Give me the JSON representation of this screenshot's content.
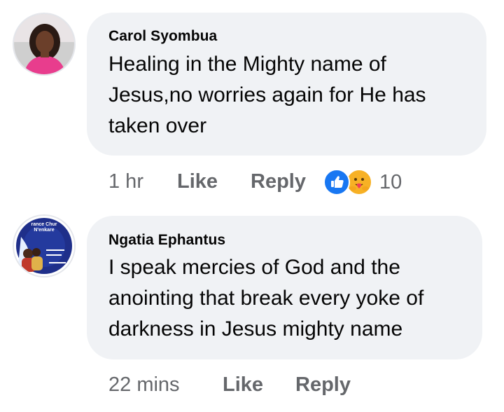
{
  "comments": [
    {
      "author": "Carol Syombua",
      "text_lines": [
        "Healing in the Mighty name of",
        "Jesus,no worries again for He has",
        "taken over"
      ],
      "time": "1 hr",
      "like_label": "Like",
      "reply_label": "Reply",
      "reactions": [
        "like-reaction",
        "care-reaction"
      ],
      "reaction_count": "10"
    },
    {
      "author": "Ngatia Ephantus",
      "avatar_text": [
        "rance Chur",
        "N'enkare"
      ],
      "text_lines": [
        "I speak mercies of God and the",
        "anointing that break every yoke of",
        "darkness in Jesus mighty name"
      ],
      "time": "22 mins",
      "like_label": "Like",
      "reply_label": "Reply"
    }
  ],
  "colors": {
    "bubble": "#f0f2f5",
    "meta_text": "#65676b",
    "like_blue": "#1877f2",
    "care_yellow": "#f7b125"
  }
}
